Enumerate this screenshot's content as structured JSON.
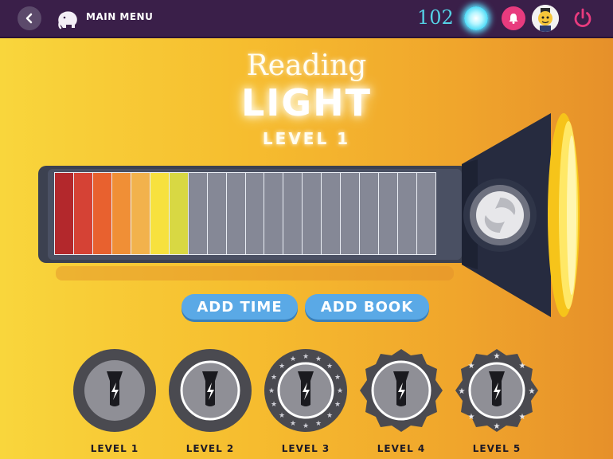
{
  "topbar": {
    "main_menu_label": "MAIN MENU",
    "points": "102"
  },
  "title": {
    "line1": "Reading",
    "line2": "LIGHT",
    "level": "LEVEL 1"
  },
  "meter": {
    "total_segments": 20,
    "filled_segments": 7,
    "segment_colors": [
      "#b3282c",
      "#d54235",
      "#e8612f",
      "#f08f36",
      "#f2b24c",
      "#f7e13e",
      "#d8d843"
    ],
    "empty_color": "#858896"
  },
  "actions": {
    "add_time": "ADD TIME",
    "add_book": "ADD BOOK"
  },
  "levels": [
    {
      "label": "LEVEL 1"
    },
    {
      "label": "LEVEL 2"
    },
    {
      "label": "LEVEL 3"
    },
    {
      "label": "LEVEL 4"
    },
    {
      "label": "LEVEL 5"
    }
  ],
  "colors": {
    "accent_blue": "#5aa9e6",
    "topbar_bg": "#3a1f49",
    "points_cyan": "#55d2e6",
    "bell_pink": "#e83b7e"
  }
}
